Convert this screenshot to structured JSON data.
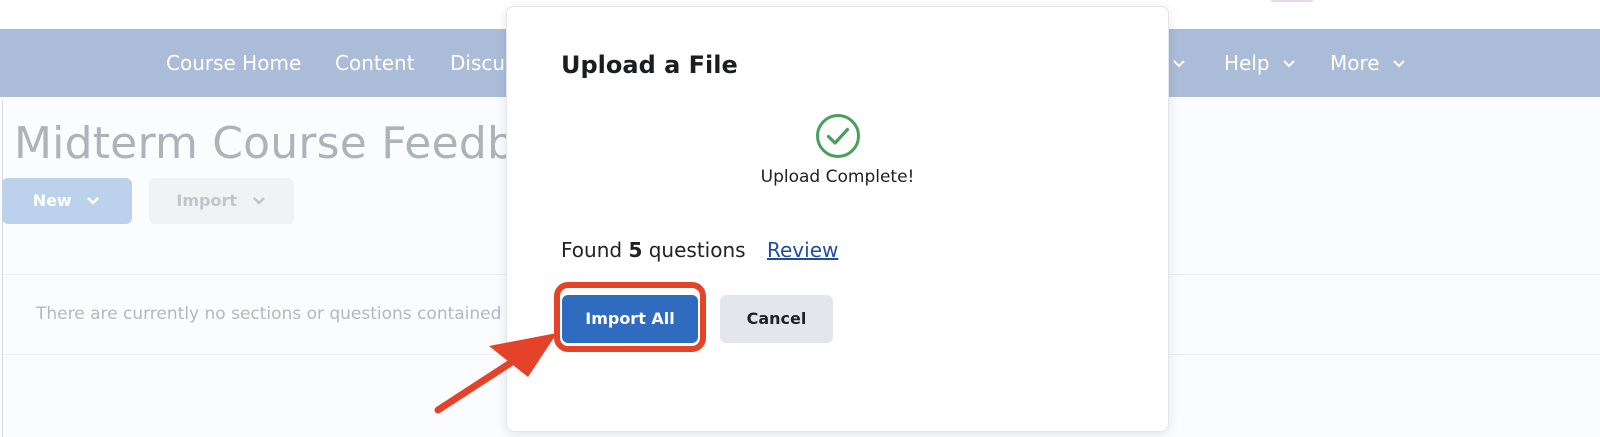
{
  "nav": {
    "items": [
      {
        "label": "Course Home",
        "has_chevron": false
      },
      {
        "label": "Content",
        "has_chevron": false
      },
      {
        "label": "Discus",
        "has_chevron": false
      },
      {
        "label": "Help",
        "has_chevron": true
      },
      {
        "label": "More",
        "has_chevron": true
      }
    ],
    "colors": {
      "bar": "#abbcd9",
      "text": "#ffffff"
    }
  },
  "page": {
    "title": "Midterm Course Feedbac",
    "new_button_label": "New",
    "import_button_label": "Import",
    "empty_message": "There are currently no sections or questions contained in th"
  },
  "dialog": {
    "title": "Upload a File",
    "status_text": "Upload Complete!",
    "status_icon": "check-circle-icon",
    "found_prefix": "Found",
    "found_count": "5",
    "found_suffix": "questions",
    "review_link": "Review",
    "import_all_label": "Import All",
    "cancel_label": "Cancel"
  },
  "annotation": {
    "highlight_color": "#e4432a",
    "target": "import-all-button"
  },
  "colors": {
    "accent": "#2f6cbf",
    "success": "#46a05a",
    "link": "#1f4e9e"
  }
}
